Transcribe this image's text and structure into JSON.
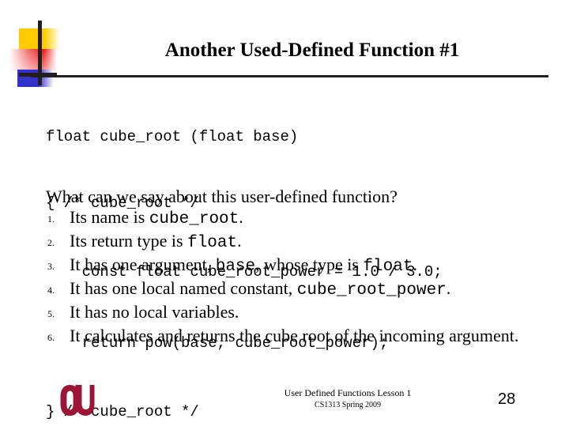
{
  "slide": {
    "title": "Another Used-Defined Function #1",
    "page_number": "28"
  },
  "code": {
    "lines": [
      "float cube_root (float base)",
      "{ /* cube_root */",
      "    const float cube_root_power = 1.0 / 3.0;",
      "    return pow(base, cube_root_power);",
      "} /* cube_root */"
    ]
  },
  "body": {
    "question": "What can we say about this user-defined function?",
    "items": [
      {
        "number": "1.",
        "parts": [
          {
            "text": "Its name is ",
            "mono": false
          },
          {
            "text": "cube_root",
            "mono": true
          },
          {
            "text": ".",
            "mono": false
          }
        ]
      },
      {
        "number": "2.",
        "parts": [
          {
            "text": "Its return type is ",
            "mono": false
          },
          {
            "text": "float",
            "mono": true
          },
          {
            "text": ".",
            "mono": false
          }
        ]
      },
      {
        "number": "3.",
        "parts": [
          {
            "text": "It has one argument, ",
            "mono": false
          },
          {
            "text": "base",
            "mono": true
          },
          {
            "text": ", whose type is ",
            "mono": false
          },
          {
            "text": "float",
            "mono": true
          },
          {
            "text": ".",
            "mono": false
          }
        ]
      },
      {
        "number": "4.",
        "parts": [
          {
            "text": "It has one local named constant, ",
            "mono": false
          },
          {
            "text": "cube_root_power",
            "mono": true
          },
          {
            "text": ".",
            "mono": false
          }
        ]
      },
      {
        "number": "5.",
        "parts": [
          {
            "text": "It has no local variables.",
            "mono": false
          }
        ]
      },
      {
        "number": "6.",
        "parts": [
          {
            "text": "It calculates and returns the cube root of the incoming argument.",
            "mono": false
          }
        ]
      }
    ]
  },
  "footer": {
    "line1": "User Defined Functions Lesson 1",
    "line2": "CS1313 Spring 2009"
  },
  "colors": {
    "gold": "#ffcc00",
    "red": "#ee1111",
    "blue": "#3333cc",
    "bar": "#231f20",
    "crimson": "#9d1535"
  }
}
